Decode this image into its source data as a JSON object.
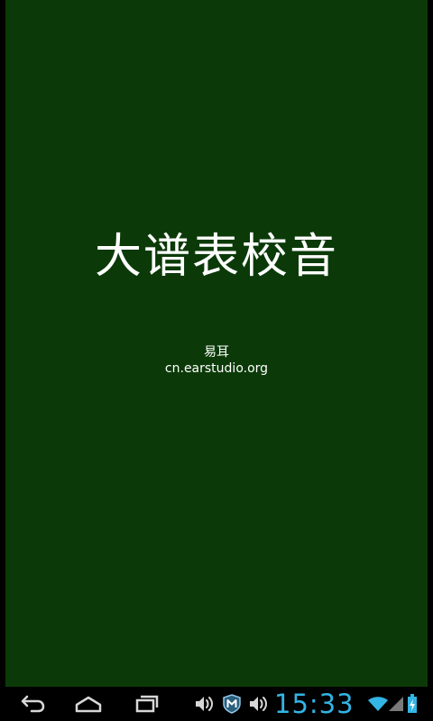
{
  "splash": {
    "title": "大谱表校音",
    "author": "易耳",
    "url": "cn.earstudio.org"
  },
  "system_bar": {
    "clock": "15:33",
    "nav_icons": [
      "back-icon",
      "home-icon",
      "recent-apps-icon"
    ],
    "notification_icons": [
      "volume-icon",
      "m-shield-icon",
      "volume-icon"
    ],
    "status_icons": [
      "wifi-icon",
      "signal-icon",
      "battery-charging-icon"
    ],
    "clock_color": "#33b5e5"
  },
  "colors": {
    "app_background": "#0b3a08",
    "text": "#ffffff",
    "system_bar": "#000000"
  }
}
